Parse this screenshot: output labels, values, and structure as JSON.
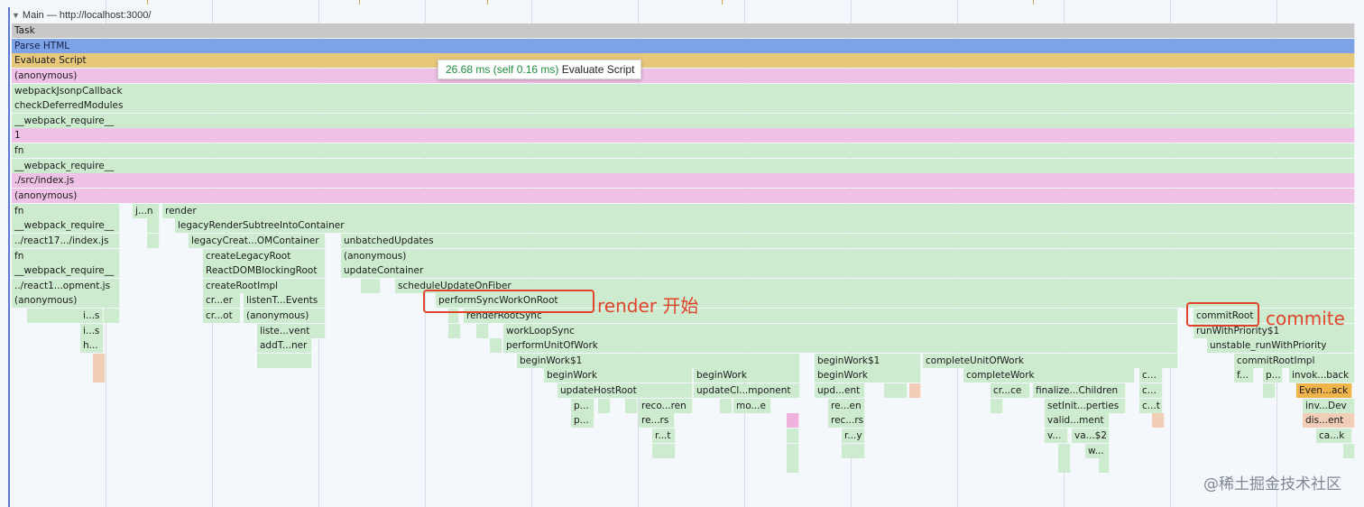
{
  "header": {
    "collapse_glyph": "▼",
    "title": "Main — http://localhost:3000/"
  },
  "tooltip": {
    "time": "26.68 ms (self 0.16 ms)",
    "name": "Evaluate Script"
  },
  "annotations": {
    "render_start": "render 开始",
    "commit": "commite"
  },
  "watermark": "@稀土掘金技术社区",
  "colors": {
    "task": "#c8c8c8",
    "parse_html": "#7ea2e6",
    "evaluate_script": "#e7c77a",
    "script_pink": "#efc1e6",
    "function_green": "#cdeccf",
    "highlight": "#e0452b"
  },
  "flame": {
    "full_rows": [
      {
        "label": "Task",
        "color": "task"
      },
      {
        "label": "Parse HTML",
        "color": "parse"
      },
      {
        "label": "Evaluate Script",
        "color": "eval"
      },
      {
        "label": "(anonymous)",
        "color": "pink"
      },
      {
        "label": "webpackJsonpCallback",
        "color": "green"
      },
      {
        "label": "checkDeferredModules",
        "color": "green"
      },
      {
        "label": "__webpack_require__",
        "color": "green"
      },
      {
        "label": "1",
        "color": "pink"
      },
      {
        "label": "fn",
        "color": "green"
      },
      {
        "label": "__webpack_require__",
        "color": "green"
      },
      {
        "label": "./src/index.js",
        "color": "pink"
      },
      {
        "label": "(anonymous)",
        "color": "pink"
      }
    ],
    "left_column": [
      "fn",
      "__webpack_require__",
      "../react17.../index.js",
      "fn",
      "__webpack_require__",
      "../react1...opment.js",
      "(anonymous)"
    ],
    "left_deep": [
      "i...s",
      "i...s",
      "h..."
    ],
    "render_branch": [
      "j...n",
      "render",
      "legacyRenderSubtreeIntoContainer",
      "legacyCreat...OMContainer",
      "createLegacyRoot",
      "ReactDOMBlockingRoot",
      "createRootImpl",
      "cr...er",
      "listenT...Events",
      "cr...ot",
      "(anonymous)",
      "liste...vent",
      "addT...ner"
    ],
    "update_branch": [
      "unbatchedUpdates",
      "(anonymous)",
      "updateContainer",
      "scheduleUpdateOnFiber",
      "performSyncWorkOnRoot",
      "renderRootSync",
      "workLoopSync",
      "performUnitOfWork",
      "beginWork$1",
      "beginWork",
      "updateHostRoot",
      "p...",
      "reco...ren",
      "p...",
      "re...rs",
      "r...t",
      "beginWork",
      "updateCl...mponent",
      "mo...e"
    ],
    "mid_branch": [
      "beginWork$1",
      "beginWork",
      "upd...ent",
      "re...en",
      "rec...rs",
      "r...y",
      "completeUnitOfWork",
      "completeWork",
      "cr...ce",
      "finalize...Children",
      "setInit...perties",
      "valid...ment",
      "v...",
      "va...$2",
      "w...",
      "c...",
      "c...",
      "c...t"
    ],
    "commit_branch": [
      "commitRoot",
      "runWithPriority$1",
      "unstable_runWithPriority",
      "commitRootImpl",
      "f...",
      "p...",
      "invok...back",
      "Even...ack",
      "inv...Dev",
      "dis...ent",
      "ca...k"
    ]
  }
}
